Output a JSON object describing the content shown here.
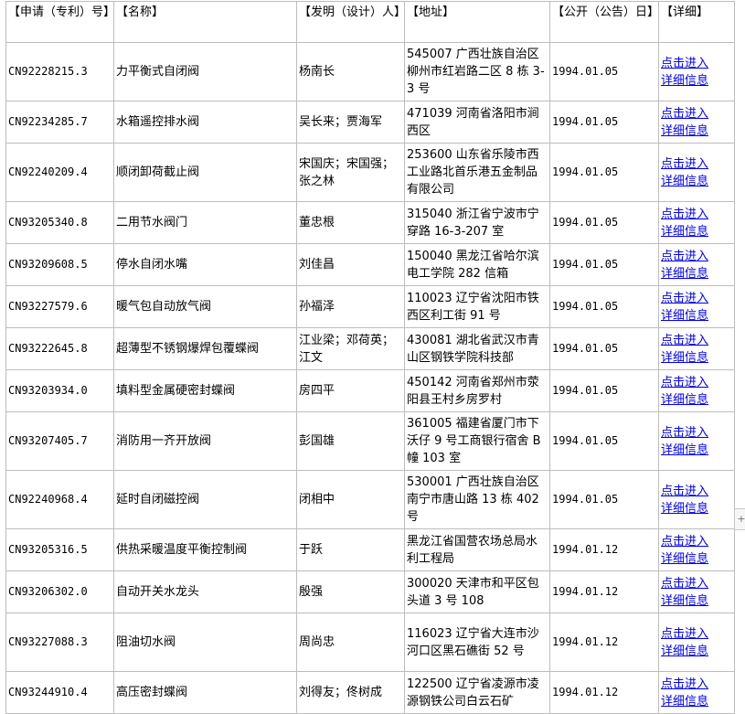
{
  "headers": {
    "appno": "【申请（专利）号】",
    "name": "【名称】",
    "inventor": "【发明（设计）人】",
    "address": "【地址】",
    "pubdate": "【公开（公告）日】",
    "detail": "【详细】"
  },
  "rows": [
    {
      "appno": "CN92228215.3",
      "name": "力平衡式自闭阀",
      "inventor": "杨南长",
      "address": "545007 广西壮族自治区柳州市红岩路二区 8 栋 3-3 号",
      "pubdate": "1994.01.05",
      "link1": "点击进入",
      "link2": "详细信息"
    },
    {
      "appno": "CN92234285.7",
      "name": "水箱遥控排水阀",
      "inventor": "吴长来；贾海军",
      "address": "471039 河南省洛阳市涧西区",
      "pubdate": "1994.01.05",
      "link1": "点击进入",
      "link2": "详细信息"
    },
    {
      "appno": "CN92240209.4",
      "name": "顺闭卸荷截止阀",
      "inventor": "宋国庆；宋国强；张之林",
      "address": "253600 山东省乐陵市西工业路北首乐港五金制品有限公司",
      "pubdate": "1994.01.05",
      "link1": "点击进入",
      "link2": "详细信息"
    },
    {
      "appno": "CN93205340.8",
      "name": "二用节水阀门",
      "inventor": "董忠根",
      "address": "315040 浙江省宁波市宁穿路 16-3-207 室",
      "pubdate": "1994.01.05",
      "link1": "点击进入",
      "link2": "详细信息"
    },
    {
      "appno": "CN93209608.5",
      "name": "停水自闭水嘴",
      "inventor": "刘佳昌",
      "address": "150040 黑龙江省哈尔滨电工学院 282 信箱",
      "pubdate": "1994.01.05",
      "link1": "点击进入",
      "link2": "详细信息"
    },
    {
      "appno": "CN93227579.6",
      "name": "暖气包自动放气阀",
      "inventor": "孙福泽",
      "address": "110023 辽宁省沈阳市铁西区利工街 91 号",
      "pubdate": "1994.01.05",
      "link1": "点击进入",
      "link2": "详细信息"
    },
    {
      "appno": "CN93222645.8",
      "name": "超薄型不锈钢爆焊包覆蝶阀",
      "inventor": "江业梁；邓荷英；江文",
      "address": "430081 湖北省武汉市青山区钢铁学院科技部",
      "pubdate": "1994.01.05",
      "link1": "点击进入",
      "link2": "详细信息"
    },
    {
      "appno": "CN93203934.0",
      "name": "填料型金属硬密封蝶阀",
      "inventor": "房四平",
      "address": "450142 河南省郑州市荥阳县王村乡房罗村",
      "pubdate": "1994.01.05",
      "link1": "点击进入",
      "link2": "详细信息"
    },
    {
      "appno": "CN93207405.7",
      "name": "消防用一齐开放阀",
      "inventor": "彭国雄",
      "address": "361005 福建省厦门市下沃仔 9 号工商银行宿舍 B 幢 103 室",
      "pubdate": "1994.01.05",
      "link1": "点击进入",
      "link2": "详细信息"
    },
    {
      "appno": "CN92240968.4",
      "name": "延时自闭磁控阀",
      "inventor": "闭相中",
      "address": "530001 广西壮族自治区南宁市唐山路 13 栋 402 号",
      "pubdate": "1994.01.05",
      "link1": "点击进入",
      "link2": "详细信息"
    },
    {
      "appno": "CN93205316.5",
      "name": "供热采暖温度平衡控制阀",
      "inventor": "于跃",
      "address": "黑龙江省国营农场总局水利工程局",
      "pubdate": "1994.01.12",
      "link1": "点击进入",
      "link2": "详细信息"
    },
    {
      "appno": "CN93206302.0",
      "name": "自动开关水龙头",
      "inventor": "殷强",
      "address": "300020 天津市和平区包头道 3 号 108",
      "pubdate": "1994.01.12",
      "link1": "点击进入",
      "link2": "详细信息"
    },
    {
      "appno": "CN93227088.3",
      "name": "阻油切水阀",
      "inventor": "周尚忠",
      "address": "116023 辽宁省大连市沙河口区黑石礁街 52 号",
      "pubdate": "1994.01.12",
      "link1": "点击进入",
      "link2": "详细信息"
    },
    {
      "appno": "CN93244910.4",
      "name": "高压密封蝶阀",
      "inventor": "刘得友；佟树成",
      "address": "122500 辽宁省凌源市凌源钢铁公司白云石矿",
      "pubdate": "1994.01.12",
      "link1": "点击进入",
      "link2": "详细信息"
    }
  ],
  "scroll_arrow": "+"
}
